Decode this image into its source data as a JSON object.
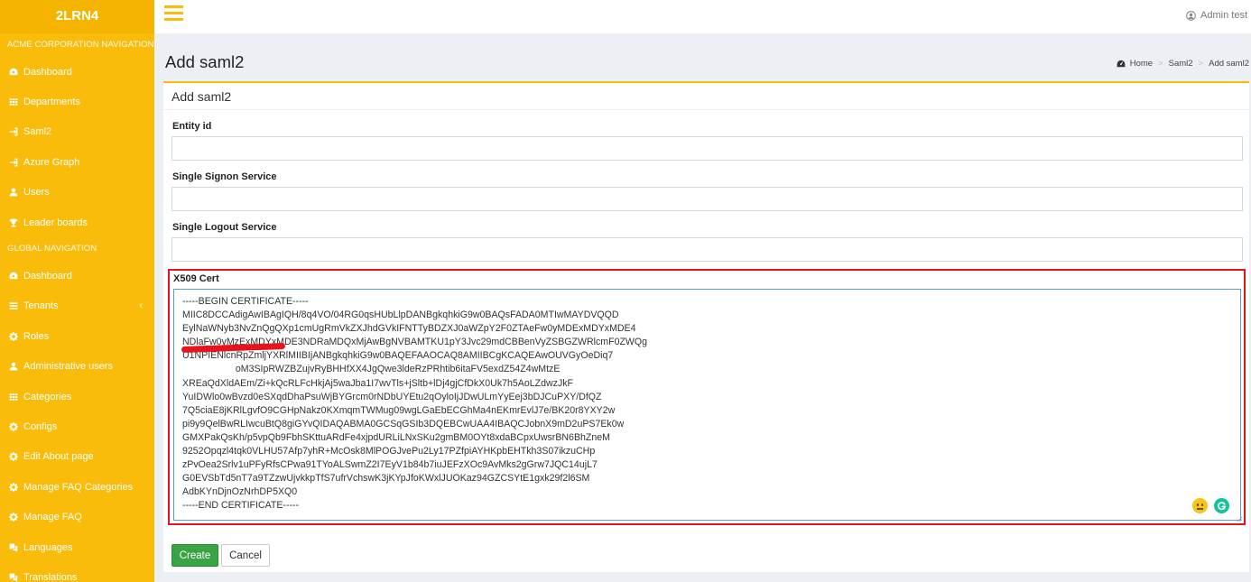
{
  "brand": "2LRN4",
  "sidebar": {
    "section1": "ACME CORPORATION NAVIGATION",
    "items1": [
      {
        "label": "Dashboard",
        "icon": "dashboard-icon"
      },
      {
        "label": "Departments",
        "icon": "grid-icon"
      },
      {
        "label": "Saml2",
        "icon": "sign-in-icon"
      },
      {
        "label": "Azure Graph",
        "icon": "sign-in-icon"
      },
      {
        "label": "Users",
        "icon": "user-icon"
      },
      {
        "label": "Leader boards",
        "icon": "trophy-icon"
      }
    ],
    "section2": "GLOBAL NAVIGATION",
    "items2": [
      {
        "label": "Dashboard",
        "icon": "dashboard-icon"
      },
      {
        "label": "Tenants",
        "icon": "list-icon"
      },
      {
        "label": "Roles",
        "icon": "gear-icon"
      },
      {
        "label": "Administrative users",
        "icon": "user-icon"
      },
      {
        "label": "Categories",
        "icon": "grid-icon"
      },
      {
        "label": "Configs",
        "icon": "gear-icon"
      },
      {
        "label": "Edit About page",
        "icon": "gear-icon"
      },
      {
        "label": "Manage FAQ Categories",
        "icon": "gear-icon"
      },
      {
        "label": "Manage FAQ",
        "icon": "gear-icon"
      },
      {
        "label": "Languages",
        "icon": "language-icon"
      },
      {
        "label": "Translations",
        "icon": "language-icon"
      }
    ]
  },
  "topbar": {
    "user": "Admin test"
  },
  "page": {
    "title": "Add saml2",
    "breadcrumb": [
      "Home",
      "Saml2",
      "Add saml2"
    ]
  },
  "form": {
    "box_title": "Add saml2",
    "entity_id_label": "Entity id",
    "entity_id_value": "",
    "signon_label": "Single Signon Service",
    "signon_value": "",
    "logout_label": "Single Logout Service",
    "logout_value": "",
    "cert_label": "X509 Cert",
    "cert_value": "-----BEGIN CERTIFICATE-----\nMIIC8DCCAdigAwIBAgIQH/8q4VO/04RG0qsHUbLlpDANBgkqhkiG9w0BAQsFADA0MTIwMAYDVQQD\nEylNaWNyb3NvZnQgQXp1cmUgRmVkZXJhdGVkIFNTTyBDZXJ0aWZpY2F0ZTAeFw0yMDExMDYxMDE4\nNDlaFw0yMzExMDYxMDE3NDRaMDQxMjAwBgNVBAMTKU1pY3Jvc29mdCBBenVyZSBGZWRlcmF0ZWQg\nU1NPIENlcnRpZmljYXRlMIIBIjANBgkqhkiG9w0BAQEFAAOCAQ8AMIIBCgKCAQEAwOUVGyOeDiq7\n                    oM3SIpRWZBZujvRyBHHfXX4JgQwe3ldeRzPRhtib6itaFV5exdZ54Z4wMtzE\nXREaQdXldAEm/Zi+kQcRLFcHkjAj5waJba1I7wvTls+jSltb+lDj4gjCfDkX0Uk7h5AoLZdwzJkF\nYuIDWlo0wBvzd0eSXqdDhaPsuWjBYGrcm0rNDbUYEtu2qOyloIjJDwULmYyEej3bDJCuPXY/DfQZ\n7Q5ciaE8jKRlLgvfO9CGHpNakz0KXmqmTWMug09wgLGaEbECGhMa4nEKmrEvlJ7e/BK20r8YXY2w\npi9y9QelBwRLIwcuBtQ8giGYvQIDAQABMA0GCSqGSIb3DQEBCwUAA4IBAQCJobnX9mD2uPS7Ek0w\nGMXPakQsKh/p5vpQb9FbhSKttuARdFe4xjpdURLiLNxSKu2gmBM0OYt8xdaBCpxUwsrBN6BhZneM\n9252Opqzl4tqk0VLHU57Afp7yhR+McOsk8MlPOGJvePu2Ly17PZfpiAYHKpbEHTkh3S07ikzuCHp\nzPvOea2Srlv1uPFyRfsCPwa91TYoALSwmZ2I7EyV1b84b7iuJEFzXOc9AvMks2gGrw7JQC14ujL7\nG0EVSbTd5nT7a9TZzwUjvkkpTfS7ufrVchswK3jKYpJfoKWxlJUOKaz94GZCSYtE1gxk29f2l6SM\nAdbKYnDjnOzNrhDP5XQ0\n-----END CERTIFICATE-----",
    "create_label": "Create",
    "cancel_label": "Cancel"
  },
  "colors": {
    "sidebar": "#f9bc0b",
    "create_button": "#3aa445",
    "highlight_frame": "#e2171d"
  }
}
